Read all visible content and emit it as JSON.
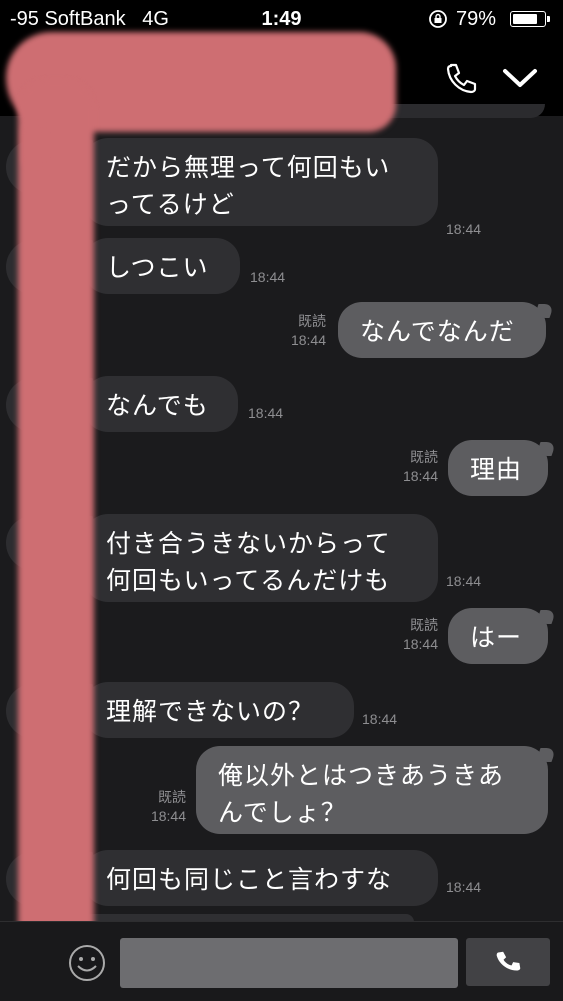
{
  "status": {
    "carrier": "-95 SoftBank",
    "network": "4G",
    "time": "1:49",
    "battery_text": "79%",
    "battery_level": 0.79
  },
  "header": {
    "call_icon": "phone-icon",
    "menu_icon": "chevron-down-icon"
  },
  "messages": [
    {
      "dir": "in",
      "text": "だから無理って何回もい\nってるけど",
      "time": "18:44",
      "read": ""
    },
    {
      "dir": "in",
      "text": "しつこい",
      "time": "18:44",
      "read": ""
    },
    {
      "dir": "out",
      "text": "なんでなんだ",
      "time": "18:44",
      "read": "既読"
    },
    {
      "dir": "in",
      "text": "なんでも",
      "time": "18:44",
      "read": ""
    },
    {
      "dir": "out",
      "text": "理由",
      "time": "18:44",
      "read": "既読"
    },
    {
      "dir": "in",
      "text": "付き合うきないからって\n何回もいってるんだけも",
      "time": "18:44",
      "read": ""
    },
    {
      "dir": "out",
      "text": "はー",
      "time": "18:44",
      "read": "既読"
    },
    {
      "dir": "in",
      "text": "理解できないの？",
      "time": "18:44",
      "read": ""
    },
    {
      "dir": "out",
      "text": "俺以外とはつきあうきあ\nんでしょ？",
      "time": "18:44",
      "read": "既読"
    },
    {
      "dir": "in",
      "text": "何回も同じこと言わすな",
      "time": "18:44",
      "read": ""
    }
  ],
  "input": {
    "placeholder": "",
    "emoji_icon": "smiley-icon",
    "send_icon": "phone-icon"
  },
  "colors": {
    "background": "#1b1b1d",
    "incoming_bubble": "#2f2f32",
    "outgoing_bubble": "#5d5d60",
    "redaction": "#ce6e72"
  }
}
